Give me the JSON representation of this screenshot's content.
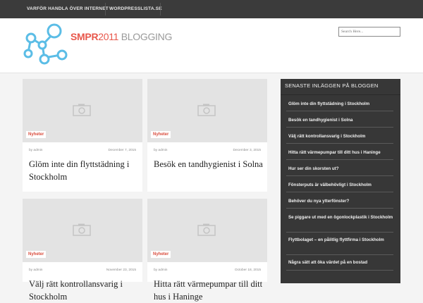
{
  "topnav": {
    "items": [
      {
        "label": "VARFÖR HANDLA ÖVER INTERNET"
      },
      {
        "label": "WORDPRESSLISTA.SE"
      }
    ]
  },
  "header": {
    "brand_part1": "SMPR",
    "brand_part2": "2011 ",
    "brand_part3": "BLOGGING",
    "logo_color": "#5bbde6",
    "search_placeholder": "Search Here..."
  },
  "posts": [
    {
      "category": "Nyheter",
      "author": "by admin",
      "date": "December 7, 2015",
      "title": "Glöm inte din flyttstädning i Stockholm"
    },
    {
      "category": "Nyheter",
      "author": "by admin",
      "date": "December 3, 2015",
      "title": "Besök en tandhygienist i Solna"
    },
    {
      "category": "Nyheter",
      "author": "by admin",
      "date": "November 23, 2015",
      "title": "Välj rätt kontrollansvarig i Stockholm"
    },
    {
      "category": "Nyheter",
      "author": "by admin",
      "date": "October 18, 2015",
      "title": "Hitta rätt värmepumpar till ditt hus i Haninge"
    }
  ],
  "sidebar": {
    "title": "SENASTE INLÄGGEN PÅ BLOGGEN",
    "items": [
      "Glöm inte din flyttstädning i Stockholm",
      "Besök en tandhygienist i Solna",
      "Välj rätt kontrollansvarig i Stockholm",
      "Hitta rätt värmepumpar till ditt hus i Haninge",
      "Hur ser din skorsten ut?",
      "Fönsterputs är välbehövligt i Stockholm",
      "Behöver du nya ytterfönster?",
      "Se piggare ut med en ögonlockplastik i Stockholm",
      "Flyttbolaget – en pålitlig flyttfirma i Stockholm",
      "Några sätt att öka värdet på en bostad"
    ]
  },
  "colors": {
    "accent": "#d94c3d",
    "topnav_bg": "#3b3b3b",
    "sidebar_bg": "#373737"
  }
}
